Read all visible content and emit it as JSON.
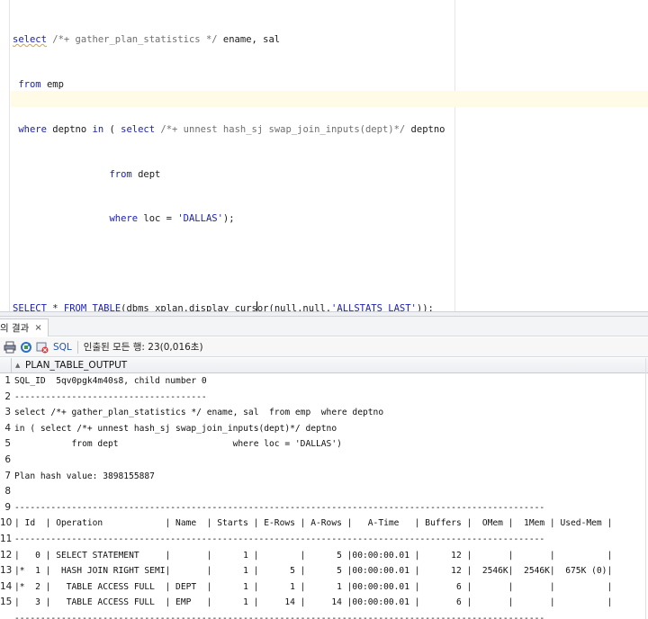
{
  "editor": {
    "lines": [
      {
        "kw1": "select",
        "cm": " /*+ gather_plan_statistics */",
        "rest": " ename, sal"
      },
      {
        "indent": " ",
        "kw1": "from",
        "rest": " emp"
      },
      {
        "indent": " ",
        "kw1": "where",
        "rest": " deptno ",
        "kw2": "in",
        "rest2": " ( ",
        "kw3": "select",
        "cm": " /*+ unnest hash_sj swap_join_inputs(dept)*/",
        "rest3": " deptno"
      },
      {
        "indent": "                 ",
        "kw1": "from",
        "rest": " dept"
      },
      {
        "indent": "                 ",
        "kw1": "where",
        "rest": " loc = ",
        "str": "'DALLAS'",
        "rest2": ");"
      }
    ],
    "query2": {
      "kw1": "SELECT",
      "mid1": " * ",
      "kw2": "FROM",
      "mid2": " ",
      "kw3": "TABLE",
      "pre_caret": "(dbms_xplan.display_curs",
      "post_caret": "or(null,null,",
      "str": "'ALLSTATS LAST'",
      "end": "));"
    }
  },
  "results": {
    "tab_label": "의 결과",
    "tab_close": "×",
    "toolbar": {
      "sql_label": "SQL",
      "status": "인출된 모든 행: 23(0,016초)"
    },
    "column_header": "PLAN_TABLE_OUTPUT",
    "rows": [
      {
        "n": "1",
        "text": "SQL_ID  5qv0pgk4m40s8, child number 0"
      },
      {
        "n": "2",
        "text": "-------------------------------------"
      },
      {
        "n": "3",
        "text": "select /*+ gather_plan_statistics */ ename, sal  from emp  where deptno"
      },
      {
        "n": "4",
        "text": "in ( select /*+ unnest hash_sj swap_join_inputs(dept)*/ deptno"
      },
      {
        "n": "5",
        "text": "           from dept                      where loc = 'DALLAS')"
      },
      {
        "n": "6",
        "text": ""
      },
      {
        "n": "7",
        "text": "Plan hash value: 3898155887"
      },
      {
        "n": "8",
        "text": ""
      },
      {
        "n": "9",
        "text": "------------------------------------------------------------------------------------------------------"
      },
      {
        "n": "10",
        "text": "| Id  | Operation            | Name  | Starts | E-Rows | A-Rows |   A-Time   | Buffers |  OMem |  1Mem | Used-Mem |"
      },
      {
        "n": "11",
        "text": "------------------------------------------------------------------------------------------------------"
      },
      {
        "n": "12",
        "text": "|   0 | SELECT STATEMENT     |       |      1 |        |      5 |00:00:00.01 |      12 |       |       |          |"
      },
      {
        "n": "13",
        "text": "|*  1 |  HASH JOIN RIGHT SEMI|       |      1 |      5 |      5 |00:00:00.01 |      12 |  2546K|  2546K|  675K (0)|"
      },
      {
        "n": "14",
        "text": "|*  2 |   TABLE ACCESS FULL  | DEPT  |      1 |      1 |      1 |00:00:00.01 |       6 |       |       |          |"
      },
      {
        "n": "15",
        "text": "|   3 |   TABLE ACCESS FULL  | EMP   |      1 |     14 |     14 |00:00:00.01 |       6 |       |       |          |"
      },
      {
        "n": "",
        "text": "------------------------------------------------------------------------------------------------------"
      }
    ]
  }
}
